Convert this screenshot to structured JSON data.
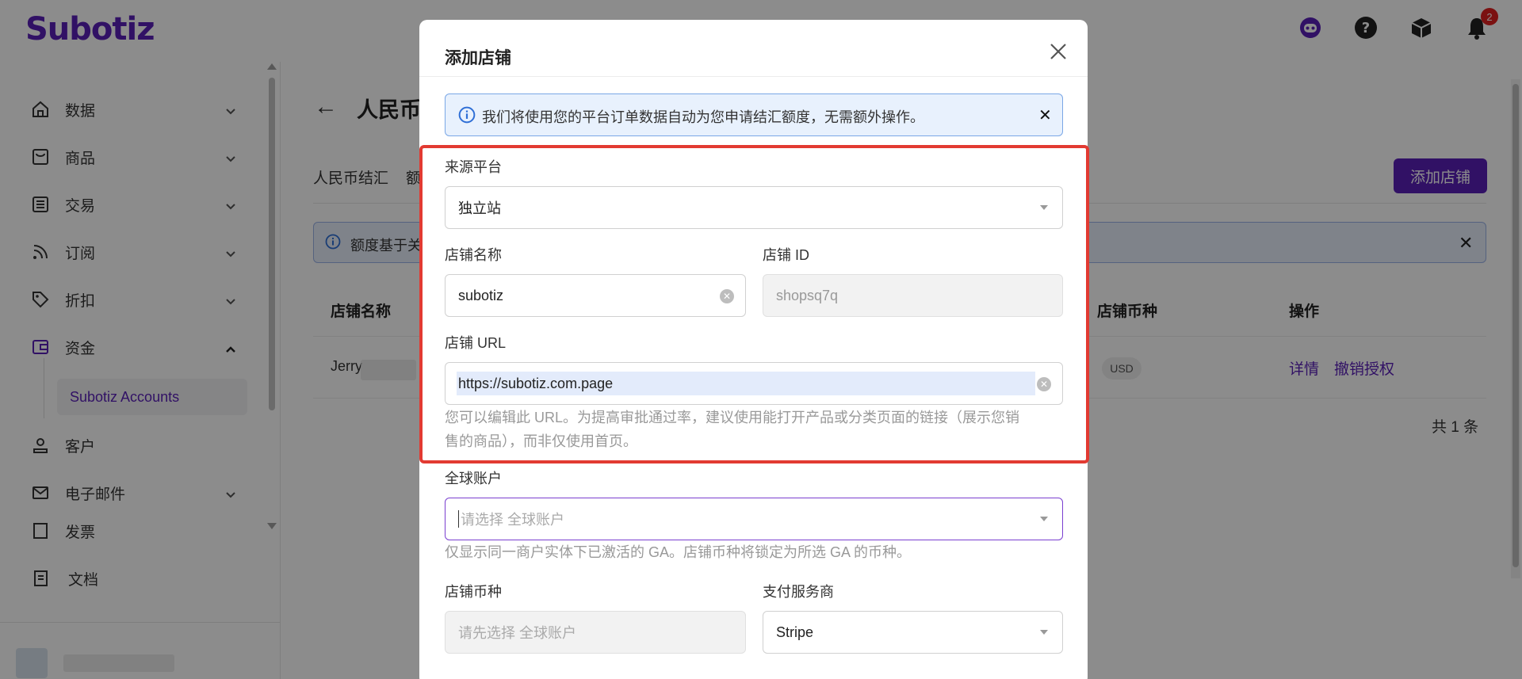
{
  "app": {
    "logo": "Subotiz",
    "notification_count": "2",
    "icons": [
      "assistant-icon",
      "help-icon",
      "package-icon",
      "bell-icon"
    ]
  },
  "sidebar": {
    "items": [
      {
        "label": "数据",
        "icon": "home-icon",
        "expanded": false
      },
      {
        "label": "商品",
        "icon": "shop-icon",
        "expanded": false
      },
      {
        "label": "交易",
        "icon": "list-icon",
        "expanded": false
      },
      {
        "label": "订阅",
        "icon": "rss-icon",
        "expanded": false
      },
      {
        "label": "折扣",
        "icon": "tag-icon",
        "expanded": false
      },
      {
        "label": "资金",
        "icon": "wallet-icon",
        "expanded": true
      },
      {
        "label": "客户",
        "icon": "user-icon",
        "expanded": false
      },
      {
        "label": "电子邮件",
        "icon": "mail-icon",
        "expanded": false
      },
      {
        "label": "发票",
        "icon": "invoice-icon",
        "expanded": false
      }
    ],
    "sub_item": "Subotiz Accounts",
    "docs": "文档"
  },
  "main": {
    "title": "人民币",
    "tabs": [
      "人民币结汇",
      "额"
    ],
    "add_store_button": "添加店铺",
    "banner_text": "额度基于关",
    "table": {
      "headers": [
        "店铺名称",
        "店铺币种",
        "操作"
      ],
      "rows": [
        {
          "store_name": "Jerry",
          "currency": "USD",
          "actions": [
            "详情",
            "撤销授权"
          ]
        }
      ]
    },
    "total": "共 1 条"
  },
  "modal": {
    "title": "添加店铺",
    "info_text": "我们将使用您的平台订单数据自动为您申请结汇额度，无需额外操作。",
    "source_platform": {
      "label": "来源平台",
      "value": "独立站"
    },
    "store_name": {
      "label": "店铺名称",
      "value": "subotiz"
    },
    "store_id": {
      "label": "店铺 ID",
      "placeholder": "shopsq7q"
    },
    "store_url": {
      "label": "店铺 URL",
      "value": "https://subotiz.com.page",
      "help_line1": "您可以编辑此 URL。为提高审批通过率，建议使用能打开产品或分类页面的链接（展示您销",
      "help_line2": "售的商品），而非仅使用首页。"
    },
    "global_account": {
      "label": "全球账户",
      "placeholder": "请选择 全球账户",
      "help": "仅显示同一商户实体下已激活的 GA。店铺币种将锁定为所选 GA 的币种。"
    },
    "store_currency": {
      "label": "店铺币种",
      "placeholder": "请先选择 全球账户"
    },
    "payment_provider": {
      "label": "支付服务商",
      "value": "Stripe"
    }
  },
  "colors": {
    "brand": "#5a1fb8",
    "highlight_box": "#e23a32",
    "info_bg": "#e8f1fd"
  }
}
